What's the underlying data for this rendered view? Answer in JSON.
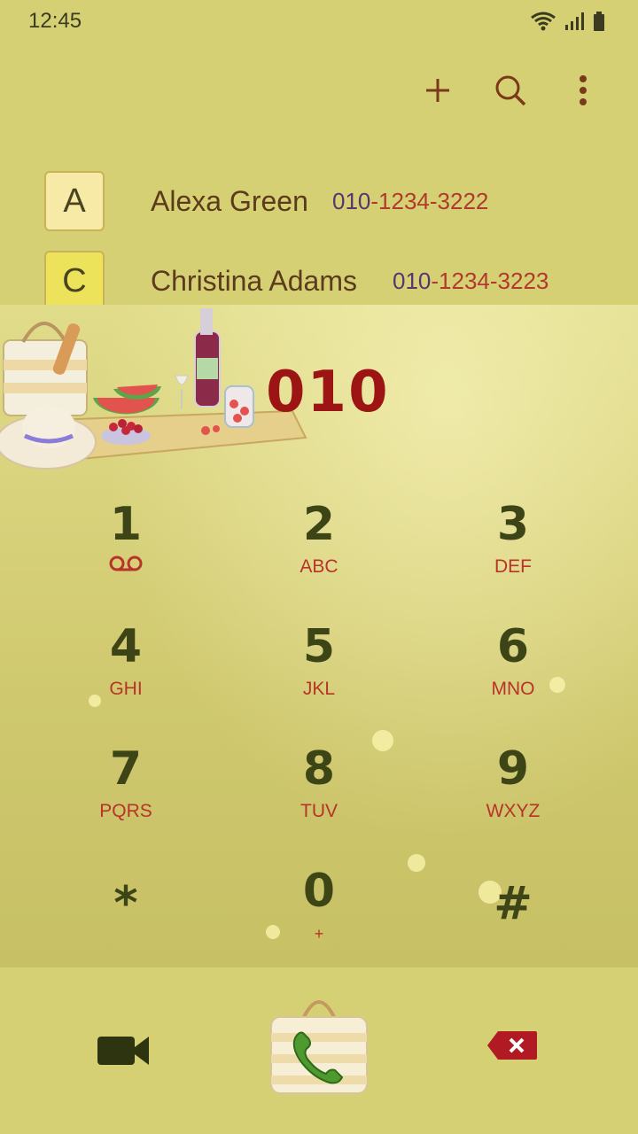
{
  "status_bar": {
    "time": "12:45"
  },
  "toolbar": {
    "add_icon": "plus-icon",
    "search_icon": "search-icon",
    "more_icon": "more-vert-icon"
  },
  "contacts": [
    {
      "initial": "A",
      "name": "Alexa Green",
      "number_prefix": "010",
      "number_rest": "-1234-3222",
      "badge_color": "#f6eaa6"
    },
    {
      "initial": "C",
      "name": "Christina Adams",
      "number_prefix": "010",
      "number_rest": "-1234-3223",
      "badge_color": "#ece35b"
    }
  ],
  "dialer": {
    "entered_number": "010",
    "keys": [
      {
        "digit": "1",
        "letters": ""
      },
      {
        "digit": "2",
        "letters": "ABC"
      },
      {
        "digit": "3",
        "letters": "DEF"
      },
      {
        "digit": "4",
        "letters": "GHI"
      },
      {
        "digit": "5",
        "letters": "JKL"
      },
      {
        "digit": "6",
        "letters": "MNO"
      },
      {
        "digit": "7",
        "letters": "PQRS"
      },
      {
        "digit": "8",
        "letters": "TUV"
      },
      {
        "digit": "9",
        "letters": "WXYZ"
      },
      {
        "digit": "*",
        "letters": ""
      },
      {
        "digit": "0",
        "letters": "+"
      },
      {
        "digit": "#",
        "letters": ""
      }
    ]
  },
  "bottom_bar": {
    "video_icon": "video-call-icon",
    "call_icon": "phone-call-icon",
    "delete_icon": "backspace-icon"
  }
}
